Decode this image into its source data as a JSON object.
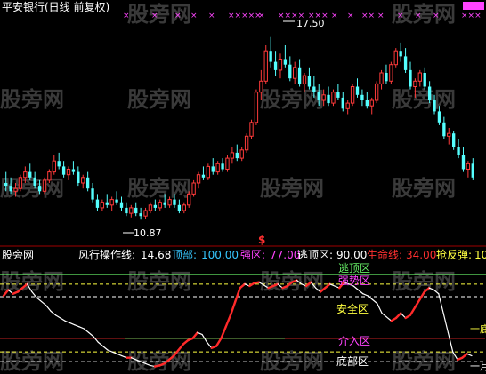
{
  "top_title": "平安银行(日线 前复权)",
  "price_labels": {
    "high": "17.50",
    "low": "10.87"
  },
  "signal_mark": "$",
  "watermark_text": "股旁网",
  "indicator": {
    "source_label": "股旁网",
    "name_label": "风行操作线:",
    "name_value": "14.68",
    "items": [
      {
        "label": "顶部:",
        "value": "100.00",
        "color": "#36c7ff"
      },
      {
        "label": "强区:",
        "value": "77.00",
        "color": "#ff44ff"
      },
      {
        "label": "逃顶区:",
        "value": "90.00",
        "color": "#ffffff"
      },
      {
        "label": "生命线:",
        "value": "34.00",
        "color": "#ff3030"
      },
      {
        "label": "抢反弹:",
        "value": "10",
        "color": "#ffff40"
      }
    ]
  },
  "zones": {
    "escape": "逃顶区",
    "strong": "强势区",
    "safe": "安全区",
    "enter": "介入区",
    "bottom": "底部区",
    "right_mark_1": "一底",
    "right_mark_2": "一月"
  },
  "colors": {
    "up": "#ff3a3a",
    "down": "#54ffff",
    "hundred": "#36c7ff",
    "white": "#ffffff",
    "magenta": "#ff44ff",
    "yellow": "#ffff40",
    "green": "#66ee66",
    "red": "#ff2a2a"
  },
  "chart_data": [
    {
      "type": "candlestick",
      "title": "平安银行(日线 前复权)",
      "annotations": [
        {
          "label": "17.50",
          "kind": "high"
        },
        {
          "label": "10.87",
          "kind": "low"
        }
      ],
      "ylim": [
        10.2,
        18.2
      ],
      "ohlc": [
        [
          12.2,
          12.6,
          11.9,
          12.1
        ],
        [
          12.1,
          12.4,
          11.8,
          11.9
        ],
        [
          11.9,
          12.2,
          11.7,
          12.0
        ],
        [
          12.0,
          12.5,
          11.9,
          12.4
        ],
        [
          12.4,
          12.8,
          12.2,
          12.6
        ],
        [
          12.6,
          12.9,
          12.3,
          12.4
        ],
        [
          12.4,
          12.6,
          12.0,
          12.1
        ],
        [
          12.1,
          12.3,
          11.8,
          11.9
        ],
        [
          11.9,
          12.4,
          11.8,
          12.3
        ],
        [
          12.3,
          12.7,
          12.2,
          12.6
        ],
        [
          12.6,
          13.2,
          12.5,
          13.0
        ],
        [
          13.0,
          13.3,
          12.7,
          12.8
        ],
        [
          12.8,
          13.0,
          12.4,
          12.5
        ],
        [
          12.5,
          12.8,
          12.3,
          12.7
        ],
        [
          12.7,
          13.0,
          12.5,
          12.6
        ],
        [
          12.6,
          12.8,
          12.1,
          12.2
        ],
        [
          12.2,
          12.5,
          12.0,
          12.4
        ],
        [
          12.4,
          12.6,
          11.9,
          12.0
        ],
        [
          12.0,
          12.2,
          11.5,
          11.6
        ],
        [
          11.6,
          11.8,
          11.2,
          11.3
        ],
        [
          11.3,
          11.6,
          11.2,
          11.5
        ],
        [
          11.5,
          11.8,
          11.3,
          11.4
        ],
        [
          11.4,
          11.7,
          11.2,
          11.6
        ],
        [
          11.6,
          11.9,
          11.4,
          11.5
        ],
        [
          11.5,
          11.7,
          11.2,
          11.3
        ],
        [
          11.3,
          11.5,
          11.0,
          11.1
        ],
        [
          11.1,
          11.4,
          10.95,
          11.3
        ],
        [
          11.3,
          11.5,
          11.0,
          11.1
        ],
        [
          11.1,
          11.3,
          10.87,
          11.0
        ],
        [
          11.0,
          11.3,
          10.9,
          11.2
        ],
        [
          11.2,
          11.5,
          11.1,
          11.4
        ],
        [
          11.4,
          11.6,
          11.2,
          11.3
        ],
        [
          11.3,
          11.6,
          11.2,
          11.5
        ],
        [
          11.5,
          11.8,
          11.3,
          11.4
        ],
        [
          11.4,
          11.7,
          11.3,
          11.6
        ],
        [
          11.6,
          11.8,
          11.3,
          11.4
        ],
        [
          11.4,
          11.6,
          11.1,
          11.2
        ],
        [
          11.2,
          11.5,
          11.1,
          11.4
        ],
        [
          11.4,
          11.9,
          11.3,
          11.8
        ],
        [
          11.8,
          12.3,
          11.7,
          12.2
        ],
        [
          12.2,
          12.6,
          12.0,
          12.5
        ],
        [
          12.5,
          12.8,
          12.3,
          12.4
        ],
        [
          12.4,
          12.9,
          12.3,
          12.8
        ],
        [
          12.8,
          13.1,
          12.5,
          12.6
        ],
        [
          12.6,
          13.0,
          12.5,
          12.9
        ],
        [
          12.9,
          13.1,
          12.6,
          12.7
        ],
        [
          12.7,
          13.2,
          12.6,
          13.1
        ],
        [
          13.1,
          13.5,
          12.9,
          13.3
        ],
        [
          13.3,
          13.6,
          13.0,
          13.1
        ],
        [
          13.1,
          13.5,
          13.0,
          13.4
        ],
        [
          13.4,
          14.0,
          13.3,
          13.9
        ],
        [
          13.9,
          14.5,
          13.8,
          14.4
        ],
        [
          14.4,
          15.6,
          14.3,
          15.5
        ],
        [
          15.5,
          16.3,
          15.2,
          15.9
        ],
        [
          15.9,
          17.2,
          15.8,
          17.0
        ],
        [
          17.0,
          17.5,
          16.4,
          16.6
        ],
        [
          16.6,
          17.0,
          16.1,
          16.3
        ],
        [
          16.3,
          16.9,
          16.0,
          16.7
        ],
        [
          16.7,
          17.2,
          16.4,
          16.5
        ],
        [
          16.5,
          16.8,
          15.9,
          16.0
        ],
        [
          16.0,
          16.6,
          15.8,
          16.4
        ],
        [
          16.4,
          16.7,
          15.7,
          15.8
        ],
        [
          15.8,
          16.2,
          15.5,
          16.1
        ],
        [
          16.1,
          16.4,
          15.6,
          15.7
        ],
        [
          15.7,
          16.1,
          15.3,
          15.5
        ],
        [
          15.5,
          15.8,
          15.0,
          15.2
        ],
        [
          15.2,
          15.6,
          15.0,
          15.4
        ],
        [
          15.4,
          15.7,
          15.0,
          15.1
        ],
        [
          15.1,
          15.6,
          15.0,
          15.5
        ],
        [
          15.5,
          15.8,
          15.2,
          15.3
        ],
        [
          15.3,
          15.5,
          14.8,
          14.9
        ],
        [
          14.9,
          15.2,
          14.7,
          15.1
        ],
        [
          15.1,
          15.8,
          15.0,
          15.7
        ],
        [
          15.7,
          16.0,
          15.3,
          15.4
        ],
        [
          15.4,
          15.6,
          15.0,
          15.2
        ],
        [
          15.2,
          15.5,
          14.9,
          15.0
        ],
        [
          15.0,
          15.3,
          14.7,
          15.2
        ],
        [
          15.2,
          15.9,
          15.1,
          15.8
        ],
        [
          15.8,
          16.3,
          15.6,
          16.2
        ],
        [
          16.2,
          16.5,
          15.8,
          15.9
        ],
        [
          15.9,
          16.6,
          15.8,
          16.5
        ],
        [
          16.5,
          17.1,
          16.4,
          17.0
        ],
        [
          17.0,
          17.3,
          16.6,
          16.8
        ],
        [
          16.8,
          17.1,
          16.2,
          16.3
        ],
        [
          16.3,
          16.6,
          15.6,
          15.7
        ],
        [
          15.7,
          16.0,
          15.3,
          15.9
        ],
        [
          15.9,
          16.3,
          15.7,
          16.2
        ],
        [
          16.2,
          16.4,
          15.6,
          15.7
        ],
        [
          15.7,
          15.9,
          15.1,
          15.2
        ],
        [
          15.2,
          15.4,
          14.7,
          14.8
        ],
        [
          14.8,
          15.0,
          14.3,
          14.4
        ],
        [
          14.4,
          14.6,
          13.8,
          13.9
        ],
        [
          13.9,
          14.2,
          13.6,
          14.0
        ],
        [
          14.0,
          14.1,
          13.4,
          13.5
        ],
        [
          13.5,
          13.8,
          13.1,
          13.2
        ],
        [
          13.2,
          13.5,
          12.6,
          12.7
        ],
        [
          12.7,
          13.0,
          12.4,
          12.9
        ],
        [
          12.9,
          13.1,
          12.3,
          12.4
        ]
      ]
    },
    {
      "type": "line",
      "title": "风行操作线",
      "ylim": [
        0,
        110
      ],
      "reference_lines": {
        "顶部": 100,
        "逃顶区": 90,
        "强区": 77,
        "生命线": 34,
        "抢反弹": 10
      },
      "values": [
        78,
        84,
        80,
        82,
        86,
        90,
        82,
        76,
        72,
        68,
        62,
        58,
        55,
        52,
        50,
        48,
        46,
        44,
        40,
        36,
        30,
        26,
        22,
        20,
        18,
        16,
        14,
        14,
        12,
        10,
        8,
        6,
        5,
        6,
        8,
        12,
        16,
        22,
        28,
        32,
        34,
        40,
        38,
        30,
        24,
        26,
        34,
        46,
        58,
        72,
        86,
        90,
        88,
        91,
        92,
        89,
        86,
        88,
        90,
        86,
        88,
        92,
        94,
        90,
        88,
        92,
        86,
        82,
        86,
        90,
        88,
        86,
        92,
        90,
        88,
        84,
        80,
        78,
        74,
        70,
        60,
        56,
        52,
        55,
        60,
        55,
        58,
        66,
        74,
        82,
        86,
        84,
        80,
        60,
        40,
        20,
        12,
        14,
        18,
        16
      ]
    }
  ]
}
